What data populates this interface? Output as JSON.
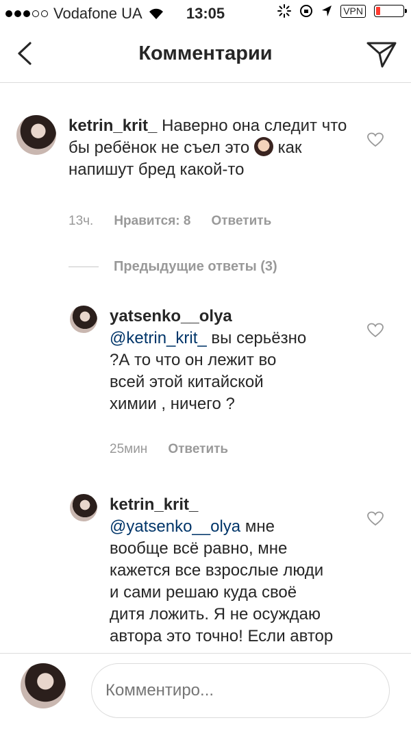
{
  "status_bar": {
    "carrier": "Vodafone UA",
    "time": "13:05",
    "vpn": "VPN",
    "battery_level": 0.15
  },
  "header": {
    "title": "Комментарии"
  },
  "comments": [
    {
      "username": "ketrin_krit_",
      "text_before_emoji": "Наверно она следит что бы ребёнок не съел это",
      "text_after_emoji": " как напишут бред какой-то",
      "time": "13ч.",
      "likes": "Нравится: 8",
      "reply": "Ответить"
    }
  ],
  "previous_replies": "Предыдущие ответы (3)",
  "replies": [
    {
      "username": "yatsenko__olya",
      "mention": "@ketrin_krit_",
      "text": " вы серьёзно ?А то что он лежит во всей этой китайской химии , ничего ?",
      "time": "25мин",
      "reply": "Ответить"
    },
    {
      "username": "ketrin_krit_",
      "mention": "@yatsenko__olya",
      "text": "  мне вообще всё равно, мне кажется все взрослые люди и сами решаю куда своё дитя ложить. Я не осуждаю автора это точно!  Если автор"
    }
  ],
  "composer": {
    "placeholder": "Комментиро..."
  }
}
